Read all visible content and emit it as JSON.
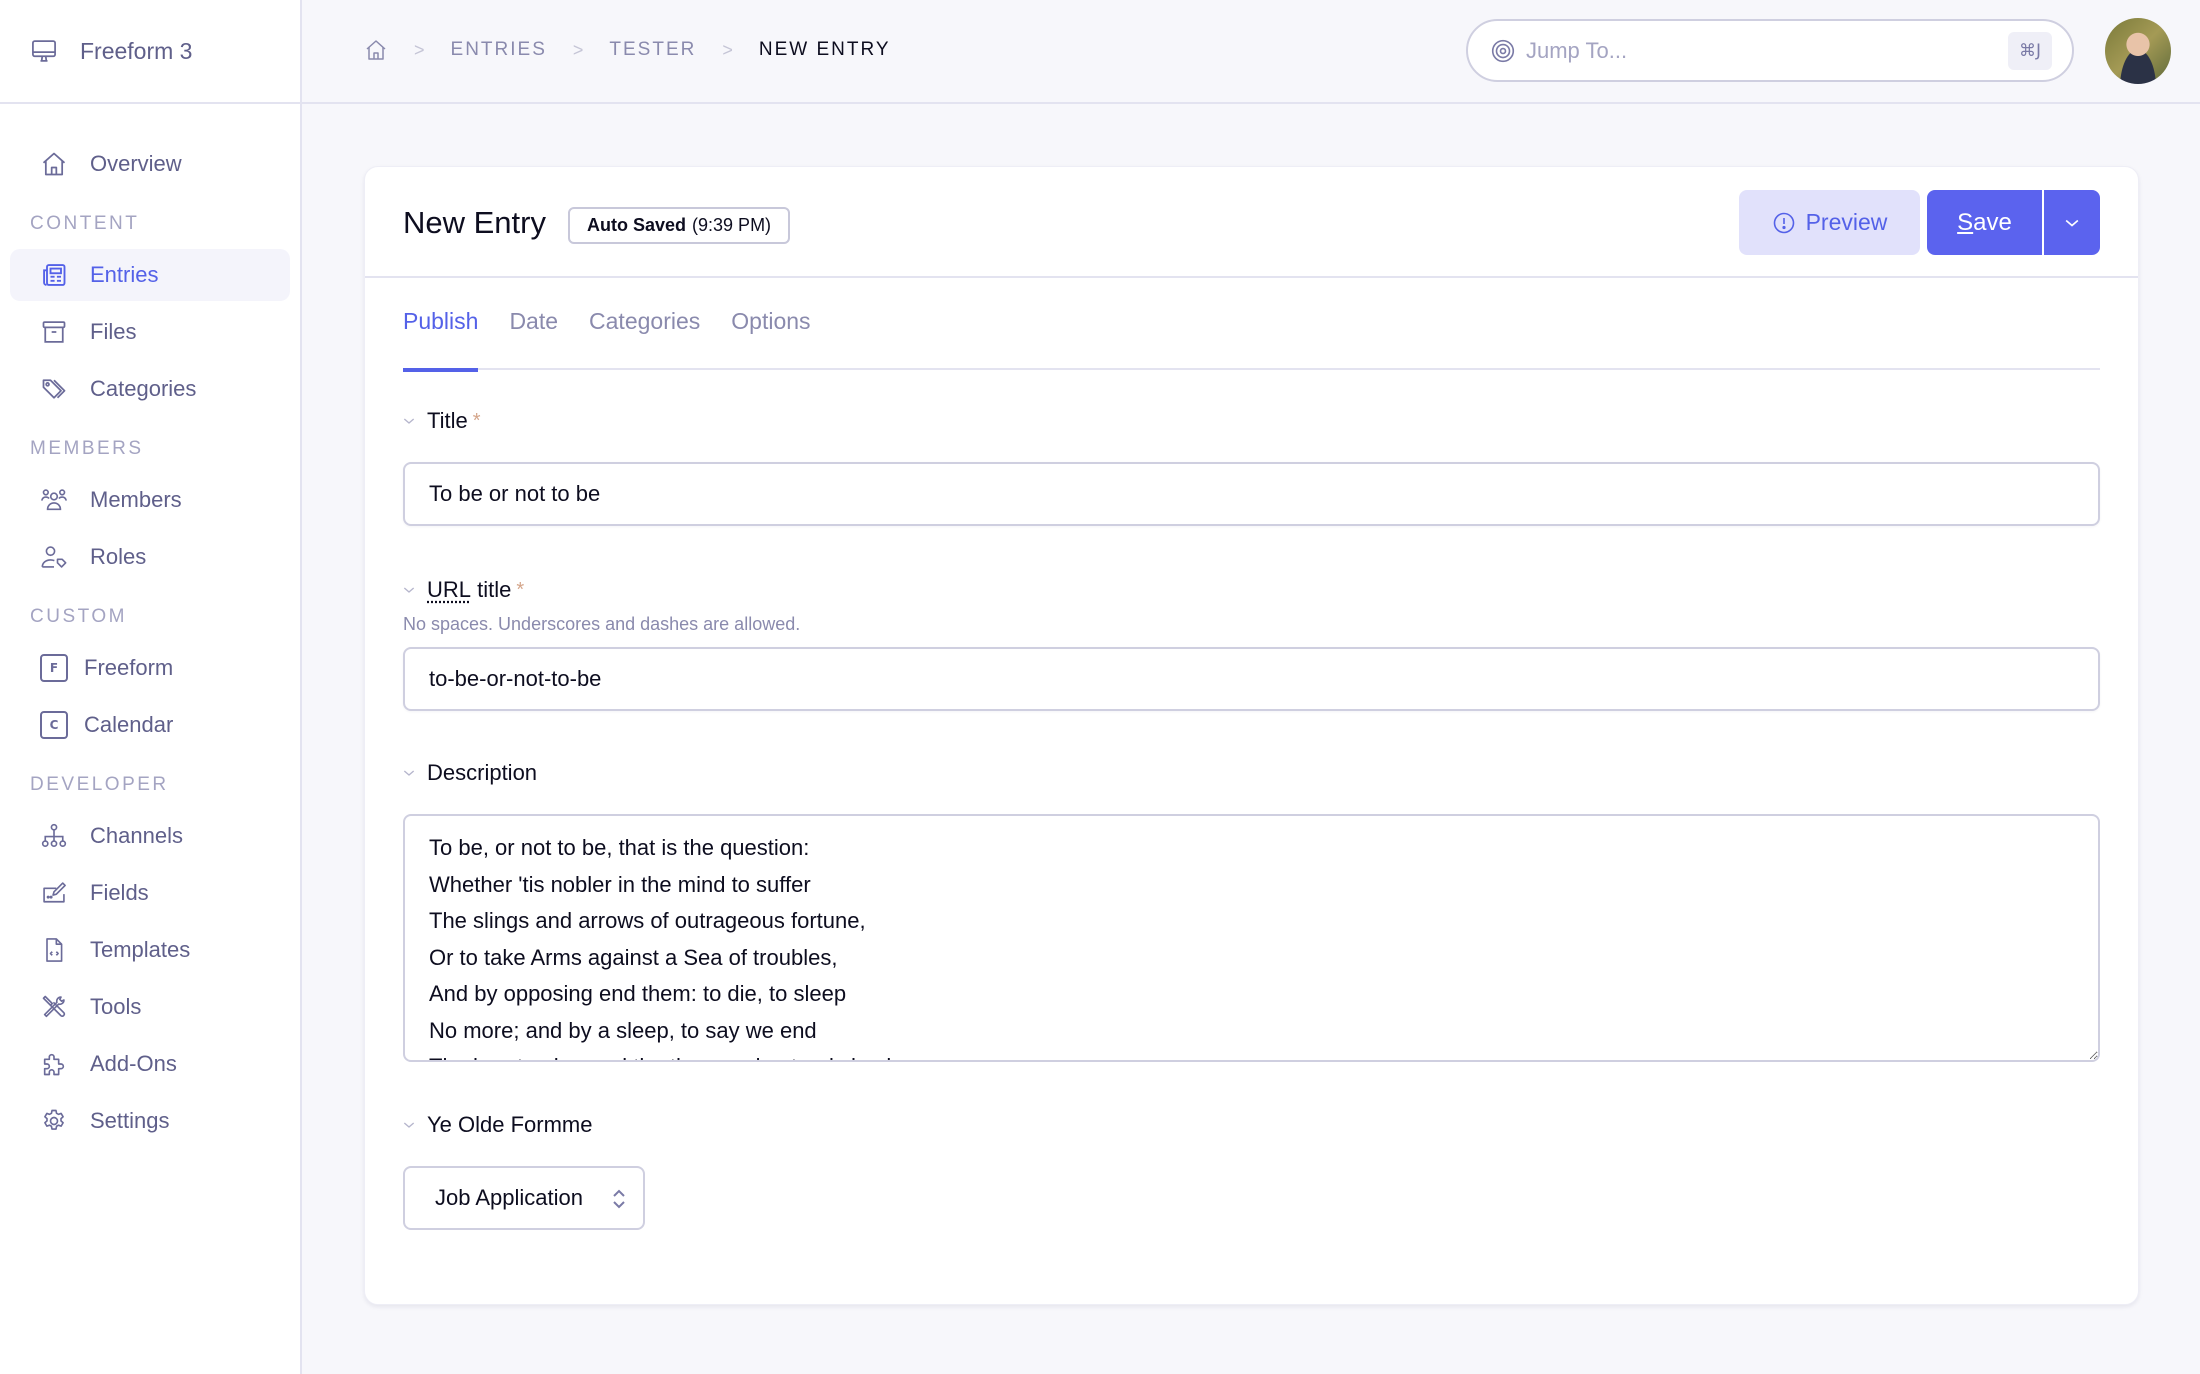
{
  "sidebar": {
    "brand": "Freeform 3",
    "overview": "Overview",
    "sections": {
      "content": "CONTENT",
      "members": "MEMBERS",
      "custom": "CUSTOM",
      "developer": "DEVELOPER"
    },
    "items": {
      "entries": "Entries",
      "files": "Files",
      "categories": "Categories",
      "members": "Members",
      "roles": "Roles",
      "freeform": "Freeform",
      "freeform_letter": "F",
      "calendar": "Calendar",
      "calendar_letter": "C",
      "channels": "Channels",
      "fields": "Fields",
      "templates": "Templates",
      "tools": "Tools",
      "addons": "Add-Ons",
      "settings": "Settings"
    },
    "active_item": "Entries"
  },
  "header": {
    "breadcrumb": [
      "ENTRIES",
      "TESTER",
      "NEW ENTRY"
    ],
    "breadcrumb_separator": ">",
    "search_placeholder": "Jump To...",
    "search_shortcut": "⌘J"
  },
  "entry": {
    "title": "New Entry",
    "autosave_label": "Auto Saved",
    "autosave_time": "(9:39 PM)",
    "preview_label": "Preview",
    "save_label_underlined": "S",
    "save_label_rest": "ave",
    "tabs": [
      "Publish",
      "Date",
      "Categories",
      "Options"
    ],
    "active_tab": "Publish"
  },
  "fields": {
    "title": {
      "label": "Title",
      "required": "*",
      "value": "To be or not to be"
    },
    "url_title": {
      "label_abbr": "URL",
      "label_rest": " title",
      "required": "*",
      "help": "No spaces. Underscores and dashes are allowed.",
      "value": "to-be-or-not-to-be"
    },
    "description": {
      "label": "Description",
      "value": "To be, or not to be, that is the question:\nWhether 'tis nobler in the mind to suffer\nThe slings and arrows of outrageous fortune,\nOr to take Arms against a Sea of troubles,\nAnd by opposing end them: to die, to sleep\nNo more; and by a sleep, to say we end\nThe heart-ache, and the thousand natural shocks"
    },
    "form": {
      "label": "Ye Olde Formme",
      "selected": "Job Application"
    }
  },
  "colors": {
    "accent": "#5461e8",
    "button_primary": "#5b63ee",
    "button_secondary_bg": "#e1e1fb",
    "muted_text": "#8a8aad",
    "required": "#d4a58a",
    "background": "#f7f7fb"
  }
}
